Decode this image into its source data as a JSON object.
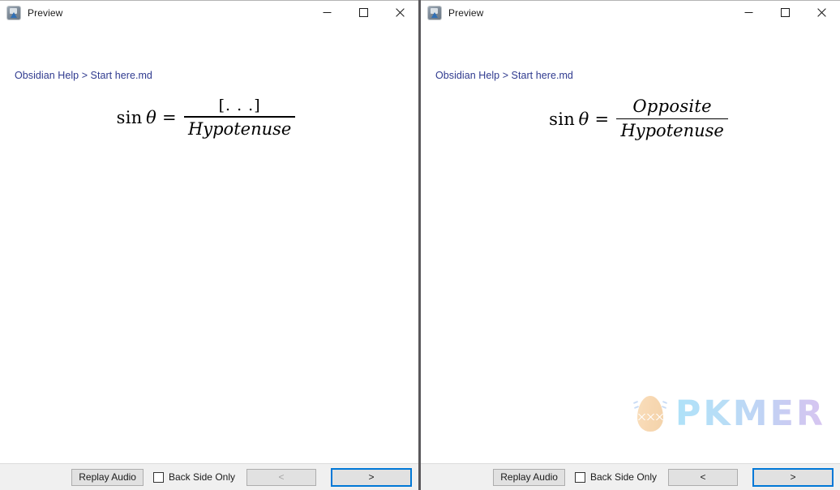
{
  "windows": [
    {
      "id": "left",
      "titlebar": {
        "title": "Preview",
        "icon": "preview-app-icon",
        "minimize_label": "—",
        "maximize_label": "□",
        "close_label": "✕"
      },
      "breadcrumb": "Obsidian Help > Start here.md",
      "math": {
        "lhs": "sin",
        "theta": "θ",
        "equals": "=",
        "numerator": "[. . .]",
        "denominator": "Hypotenuse",
        "numerator_is_placeholder": true
      },
      "watermark": null,
      "toolbar": {
        "replay_label": "Replay Audio",
        "checkbox_label": "Back Side Only",
        "checkbox_checked": false,
        "prev_label": "<",
        "prev_disabled": true,
        "next_label": ">",
        "next_focused": true
      }
    },
    {
      "id": "right",
      "titlebar": {
        "title": "Preview",
        "icon": "preview-app-icon",
        "minimize_label": "—",
        "maximize_label": "□",
        "close_label": "✕"
      },
      "breadcrumb": "Obsidian Help > Start here.md",
      "math": {
        "lhs": "sin",
        "theta": "θ",
        "equals": "=",
        "numerator": "Opposite",
        "denominator": "Hypotenuse",
        "numerator_is_placeholder": false
      },
      "watermark": {
        "text": "PKMER",
        "logo": "cracked-egg-logo"
      },
      "toolbar": {
        "replay_label": "Replay Audio",
        "checkbox_label": "Back Side Only",
        "checkbox_checked": false,
        "prev_label": "<",
        "prev_disabled": false,
        "next_label": ">",
        "next_focused": true
      }
    }
  ],
  "colors": {
    "breadcrumb_link": "#2f3a8f",
    "focus_border": "#0078d7",
    "toolbar_bg": "#f0f0f0",
    "button_bg": "#e1e1e1",
    "divider": "#5a585c"
  }
}
